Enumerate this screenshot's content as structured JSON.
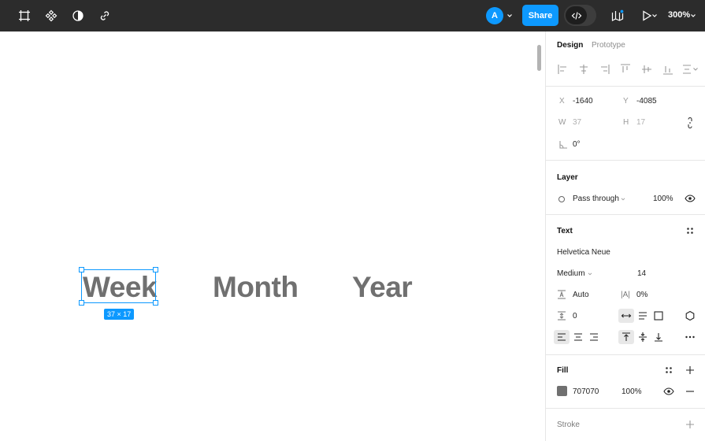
{
  "toolbar": {
    "avatar_initial": "A",
    "share_label": "Share",
    "zoom": "300%",
    "accent": "#0d99ff",
    "icons": [
      "frame-tool-icon",
      "component-icon",
      "contrast-icon",
      "link-icon",
      "library-icon",
      "play-icon"
    ]
  },
  "canvas": {
    "texts": [
      "Week",
      "Month",
      "Year"
    ],
    "selection_size": "37 × 17"
  },
  "panel": {
    "tabs": {
      "design": "Design",
      "prototype": "Prototype"
    },
    "position": {
      "x_label": "X",
      "x": "-1640",
      "y_label": "Y",
      "y": "-4085"
    },
    "size": {
      "w_label": "W",
      "w": "37",
      "h_label": "H",
      "h": "17"
    },
    "rotation": "0°",
    "layer": {
      "title": "Layer",
      "blend": "Pass through",
      "opacity": "100%"
    },
    "text": {
      "title": "Text",
      "font": "Helvetica Neue",
      "weight": "Medium",
      "size": "14",
      "line_height": "Auto",
      "letter_spacing_label": "|A|",
      "letter_spacing": "0%",
      "paragraph_spacing": "0"
    },
    "fill": {
      "title": "Fill",
      "hex": "707070",
      "opacity": "100%",
      "color": "#707070"
    },
    "stroke": {
      "title": "Stroke"
    }
  }
}
